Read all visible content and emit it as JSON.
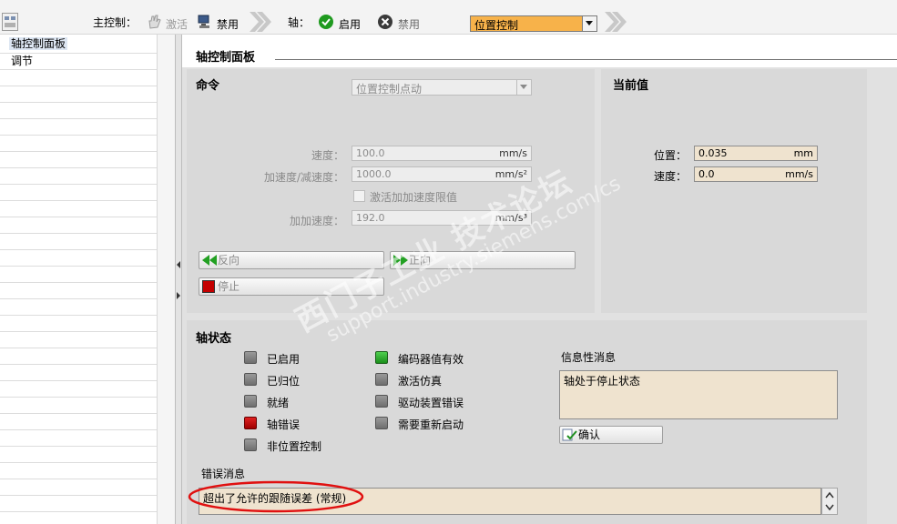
{
  "toolbar": {
    "master_control_label": "主控制：",
    "activate_label": "激活",
    "deactivate_label": "禁用",
    "axis_label": "轴：",
    "enable_label": "启用",
    "disable_label": "禁用",
    "mode_value": "位置控制"
  },
  "tree": {
    "items": [
      {
        "label": "轴控制面板"
      },
      {
        "label": "调节"
      }
    ]
  },
  "panel": {
    "title": "轴控制面板"
  },
  "command": {
    "title": "命令",
    "mode_value": "位置控制点动",
    "velocity_label": "速度：",
    "velocity_value": "100.0",
    "velocity_unit": "mm/s",
    "accel_label": "加速度/减速度：",
    "accel_value": "1000.0",
    "accel_unit": "mm/s²",
    "jerk_checkbox_label": "激活加加速度限值",
    "jerk_label": "加加速度：",
    "jerk_value": "192.0",
    "jerk_unit": "mm/s³",
    "backward_label": "反向",
    "forward_label": "正向",
    "stop_label": "停止"
  },
  "current": {
    "title": "当前值",
    "position_label": "位置：",
    "position_value": "0.035",
    "position_unit": "mm",
    "velocity_label": "速度：",
    "velocity_value": "0.0",
    "velocity_unit": "mm/s"
  },
  "axis_status": {
    "title": "轴状态",
    "left": [
      {
        "label": "已启用",
        "state": "gray"
      },
      {
        "label": "已归位",
        "state": "gray"
      },
      {
        "label": "就绪",
        "state": "gray"
      },
      {
        "label": "轴错误",
        "state": "red"
      },
      {
        "label": "非位置控制",
        "state": "gray"
      }
    ],
    "right": [
      {
        "label": "编码器值有效",
        "state": "green"
      },
      {
        "label": "激活仿真",
        "state": "gray"
      },
      {
        "label": "驱动装置错误",
        "state": "gray"
      },
      {
        "label": "需要重新启动",
        "state": "gray"
      }
    ],
    "info_label": "信息性消息",
    "info_text": "轴处于停止状态",
    "ack_label": "确认",
    "error_label": "错误消息",
    "error_text": "超出了允许的跟随误差 (常规)"
  },
  "watermark": {
    "line1": "西门子工业 技术论坛",
    "line2": "support.industry.siemens.com/cs"
  },
  "colors": {
    "field_active": "#efe3cf",
    "led_green": "#2aa52a",
    "led_red": "#c80000",
    "mode_highlight": "#f7b24a",
    "annotation_red": "#e01010"
  }
}
